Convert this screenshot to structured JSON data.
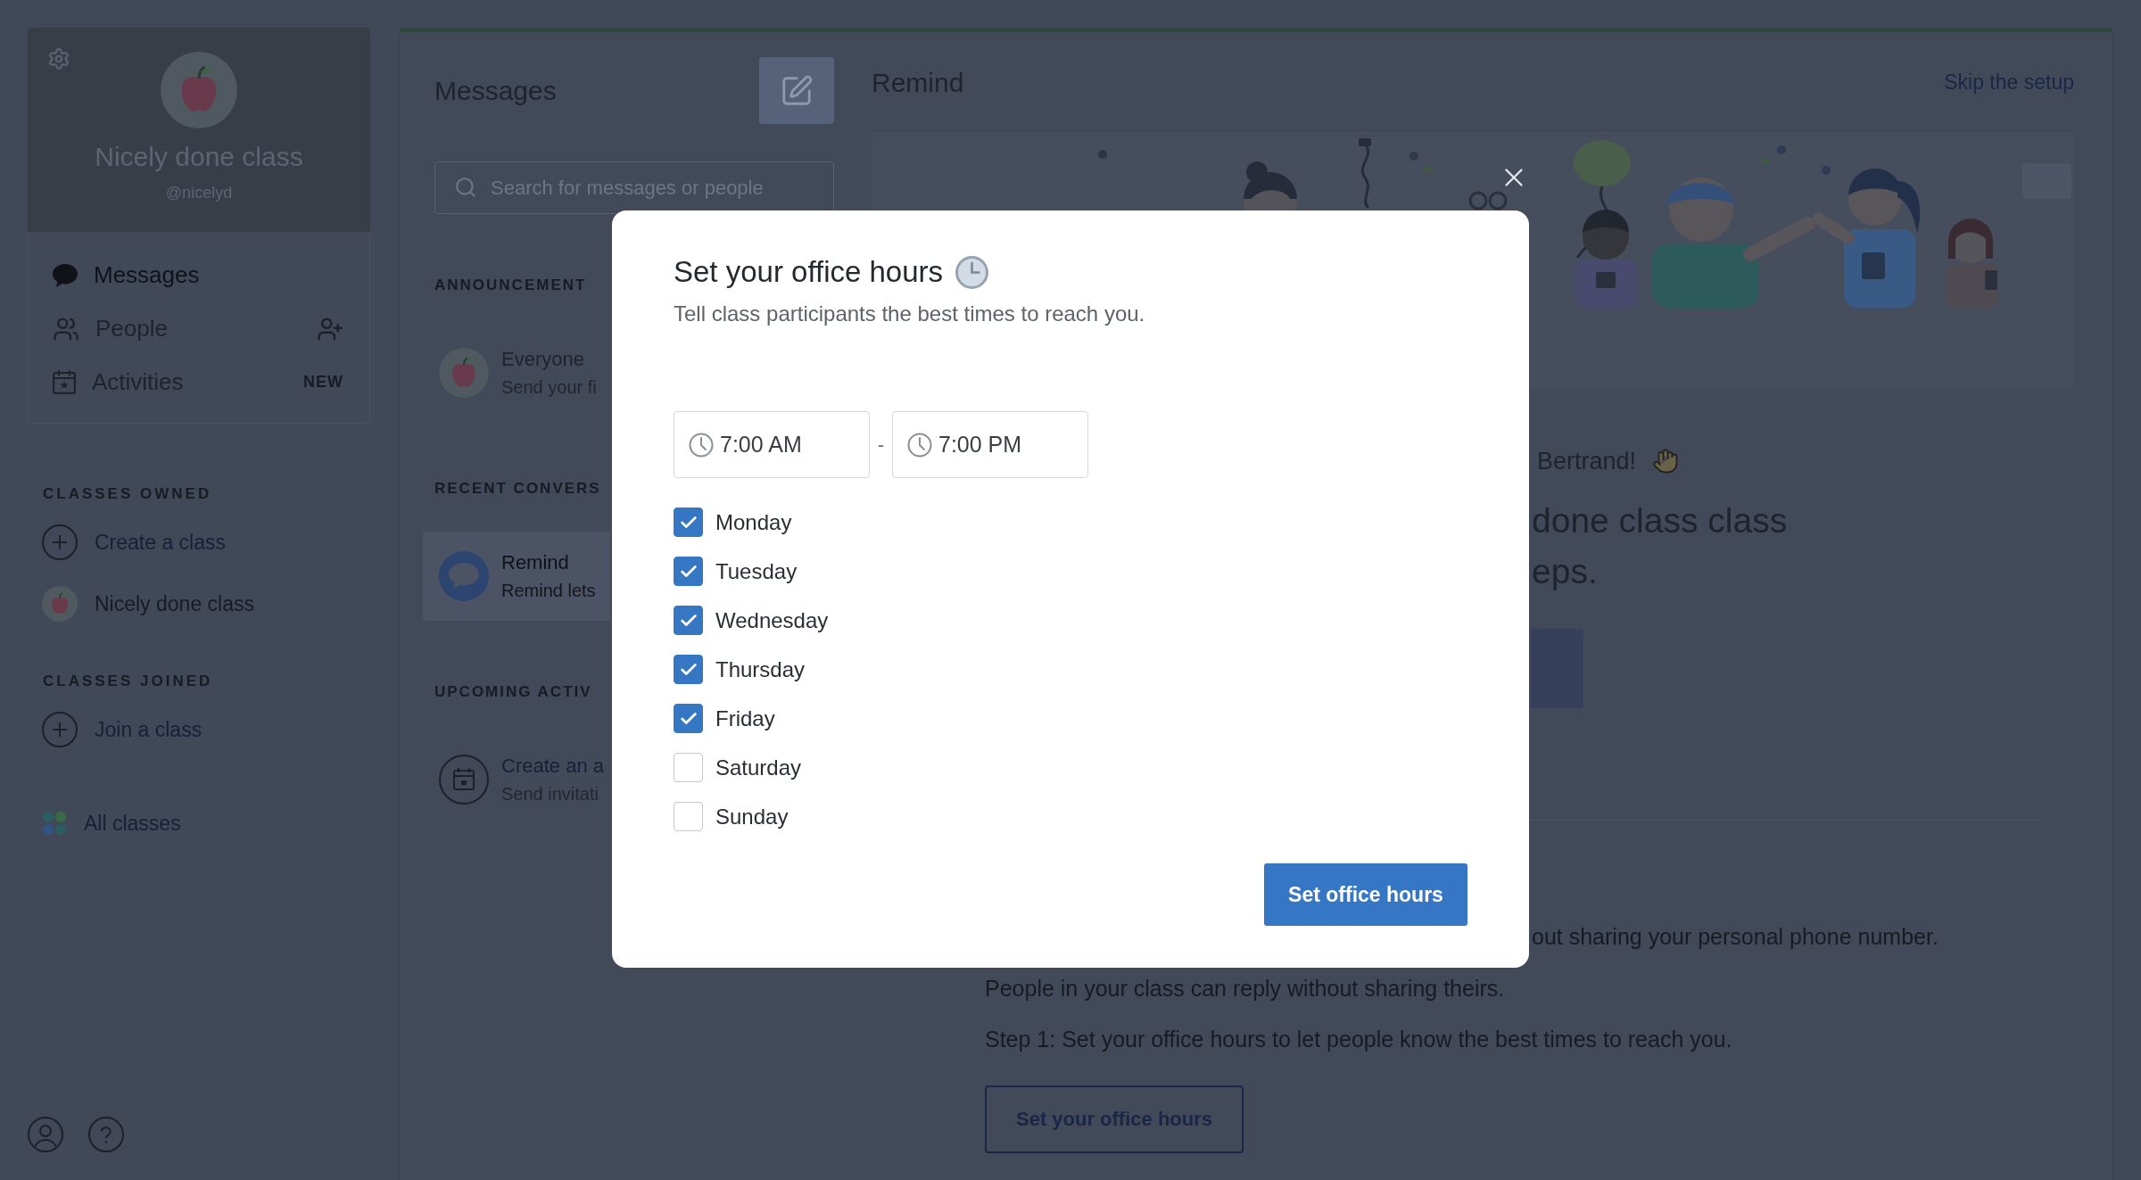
{
  "sidebar": {
    "class_card": {
      "name": "Nicely done class",
      "handle": "@nicelyd"
    },
    "nav": [
      {
        "label": "Messages",
        "selected": true
      },
      {
        "label": "People",
        "selected": false
      },
      {
        "label": "Activities",
        "selected": false,
        "badge": "NEW"
      }
    ],
    "sections": [
      {
        "heading": "CLASSES OWNED",
        "items": [
          {
            "kind": "add",
            "label": "Create a class"
          },
          {
            "kind": "class",
            "label": "Nicely done class"
          }
        ]
      },
      {
        "heading": "CLASSES JOINED",
        "items": [
          {
            "kind": "add",
            "label": "Join a class"
          }
        ]
      }
    ],
    "all_classes": "All classes"
  },
  "messages": {
    "title": "Messages",
    "search": {
      "placeholder": "Search for messages or people"
    },
    "sections": [
      {
        "heading": "ANNOUNCEMENT",
        "items": [
          {
            "kind": "class",
            "title": "Everyone",
            "subtitle": "Send your fi",
            "selected": false
          }
        ]
      },
      {
        "heading": "RECENT CONVERS",
        "items": [
          {
            "kind": "remind",
            "title": "Remind",
            "subtitle": "Remind lets",
            "selected": true
          }
        ]
      },
      {
        "heading": "UPCOMING ACTIV",
        "items": [
          {
            "kind": "event",
            "title": "Create an a",
            "subtitle": "Send invitati",
            "selected": false
          }
        ]
      }
    ]
  },
  "main": {
    "title": "Remind",
    "skip_link": "Skip the setup",
    "greeting": "Bertrand!",
    "headline": [
      "done class class",
      "eps."
    ],
    "intro_end": "out sharing your personal phone number.",
    "intro_line": "People in your class can reply without sharing theirs.",
    "step": "Step 1: Set your office hours to let people know the best times to reach you.",
    "step_button": "Set your office hours"
  },
  "dialog": {
    "title": "Set your office hours",
    "subtitle": "Tell class participants the best times to reach you.",
    "start_time": "7:00 AM",
    "separator": "-",
    "end_time": "7:00 PM",
    "days": [
      {
        "label": "Monday",
        "checked": true
      },
      {
        "label": "Tuesday",
        "checked": true
      },
      {
        "label": "Wednesday",
        "checked": true
      },
      {
        "label": "Thursday",
        "checked": true
      },
      {
        "label": "Friday",
        "checked": true
      },
      {
        "label": "Saturday",
        "checked": false
      },
      {
        "label": "Sunday",
        "checked": false
      }
    ],
    "submit_button": "Set office hours"
  }
}
